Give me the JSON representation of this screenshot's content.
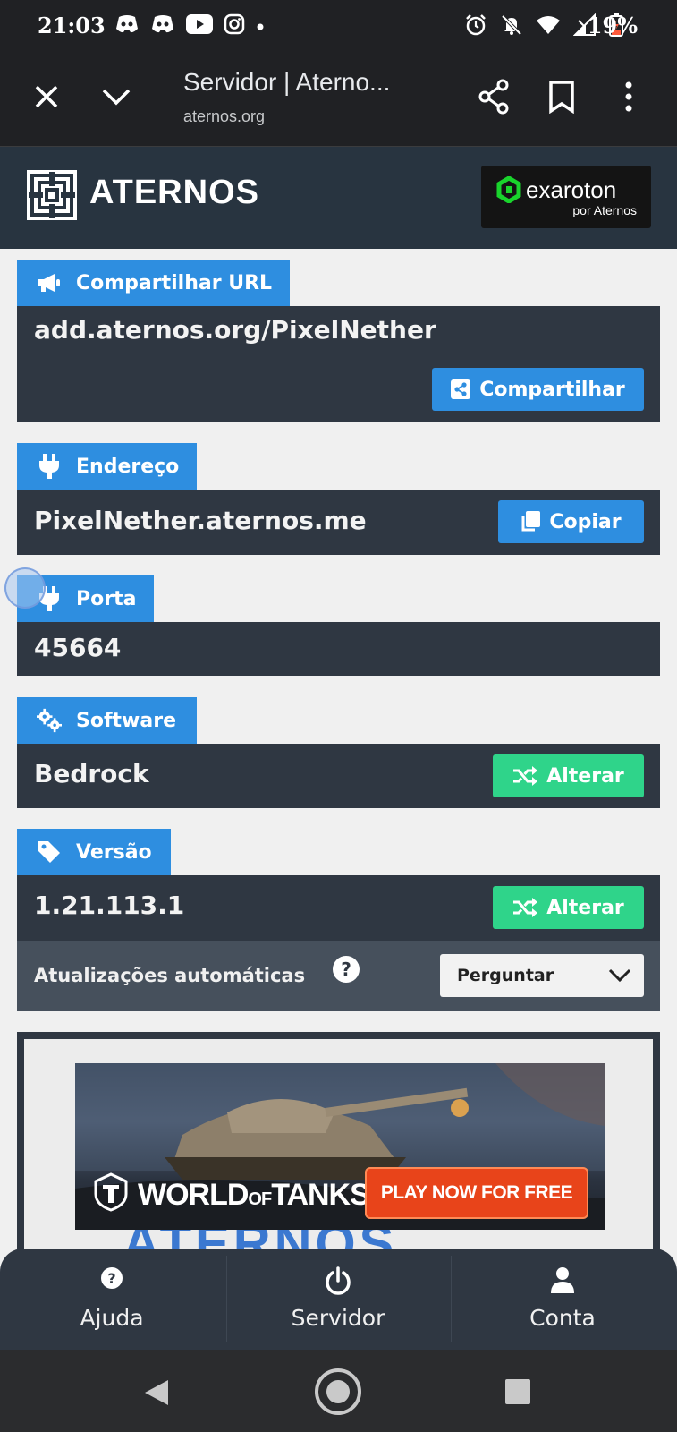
{
  "status_bar": {
    "time": "21:03",
    "battery": "19%",
    "left_icons": [
      "discord-icon",
      "discord-icon",
      "youtube-icon",
      "instagram-icon",
      "dot-icon"
    ],
    "right_icons": [
      "alarm-icon",
      "bell-off-icon",
      "wifi-icon",
      "signal-icon",
      "battery-icon"
    ]
  },
  "browser": {
    "title": "Servidor | Aterno...",
    "url": "aternos.org"
  },
  "site": {
    "brand": "ATERNOS",
    "partner_name": "exaroton",
    "partner_sub": "por Aternos"
  },
  "share": {
    "tag": "Compartilhar URL",
    "value": "add.aternos.org/PixelNether",
    "button": "Compartilhar"
  },
  "address": {
    "tag": "Endereço",
    "value": "PixelNether.aternos.me",
    "button": "Copiar"
  },
  "port": {
    "tag": "Porta",
    "value": "45664"
  },
  "software": {
    "tag": "Software",
    "value": "Bedrock",
    "button": "Alterar"
  },
  "version": {
    "tag": "Versão",
    "value": "1.21.113.1",
    "button": "Alterar",
    "auto_updates_label": "Atualizações automáticas",
    "help": "?",
    "auto_updates_value": "Perguntar"
  },
  "ad": {
    "brand": "WORLD of TANKS",
    "brand_main": "WORLD",
    "brand_of": "OF",
    "brand_end": "TANKS",
    "cta": "PLAY NOW FOR FREE"
  },
  "bottom_nav": [
    {
      "label": "Ajuda",
      "icon": "help-circle-icon"
    },
    {
      "label": "Servidor",
      "icon": "power-icon"
    },
    {
      "label": "Conta",
      "icon": "user-icon"
    }
  ],
  "colors": {
    "accent_blue": "#2e8ee0",
    "accent_green": "#2fd48a",
    "panel": "#2f3742",
    "header": "#283440"
  }
}
